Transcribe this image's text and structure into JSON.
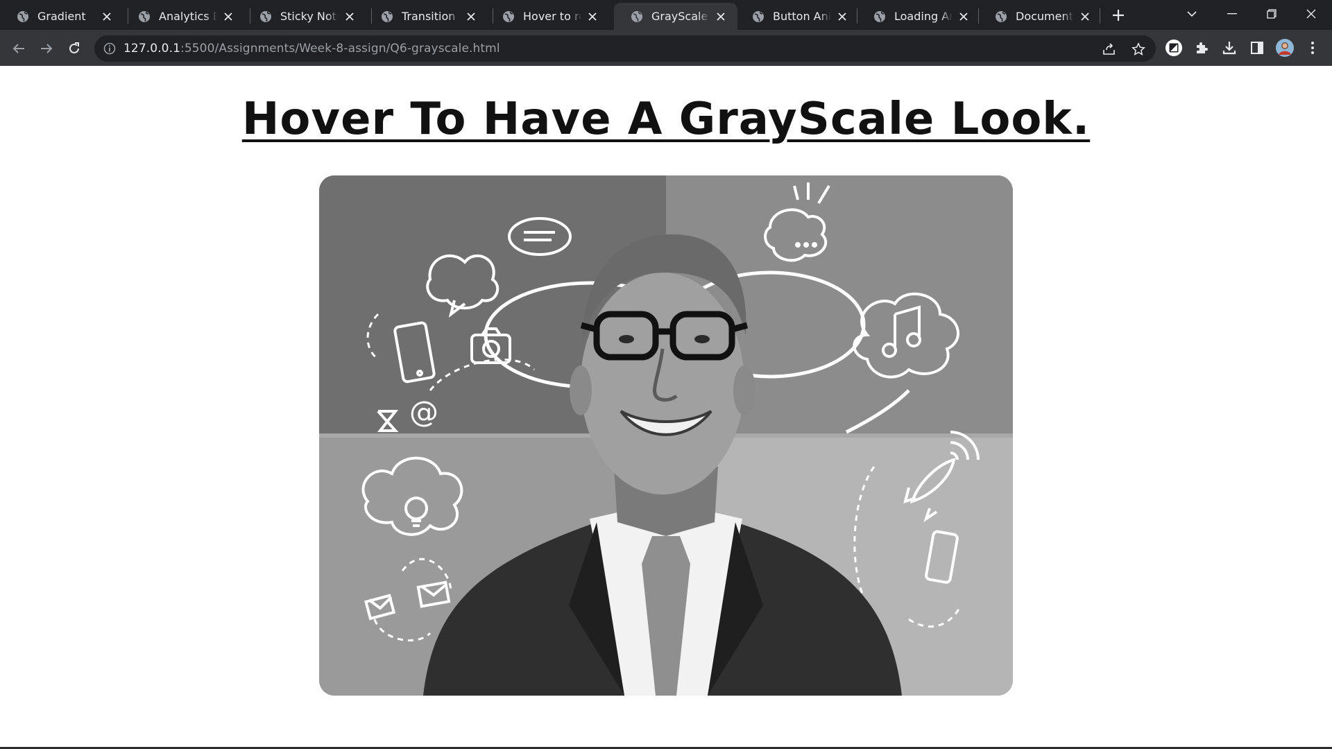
{
  "tabs": [
    {
      "title": "Gradient",
      "active": false
    },
    {
      "title": "Analytics Bar",
      "active": false
    },
    {
      "title": "Sticky Note",
      "active": false
    },
    {
      "title": "Transition",
      "active": false
    },
    {
      "title": "Hover to reveal",
      "active": false
    },
    {
      "title": "GrayScale Image",
      "active": true
    },
    {
      "title": "Button Animation",
      "active": false
    },
    {
      "title": "Loading Animation",
      "active": false
    },
    {
      "title": "Document",
      "active": false
    }
  ],
  "address_bar": {
    "host": "127.0.0.1",
    "rest": ":5500/Assignments/Week-8-assign/Q6-grayscale.html"
  },
  "page": {
    "heading": "Hover To Have A GrayScale Look."
  },
  "colors": {
    "tabstrip": "#202124",
    "toolbar": "#35363a",
    "page_bg": "#ffffff"
  }
}
